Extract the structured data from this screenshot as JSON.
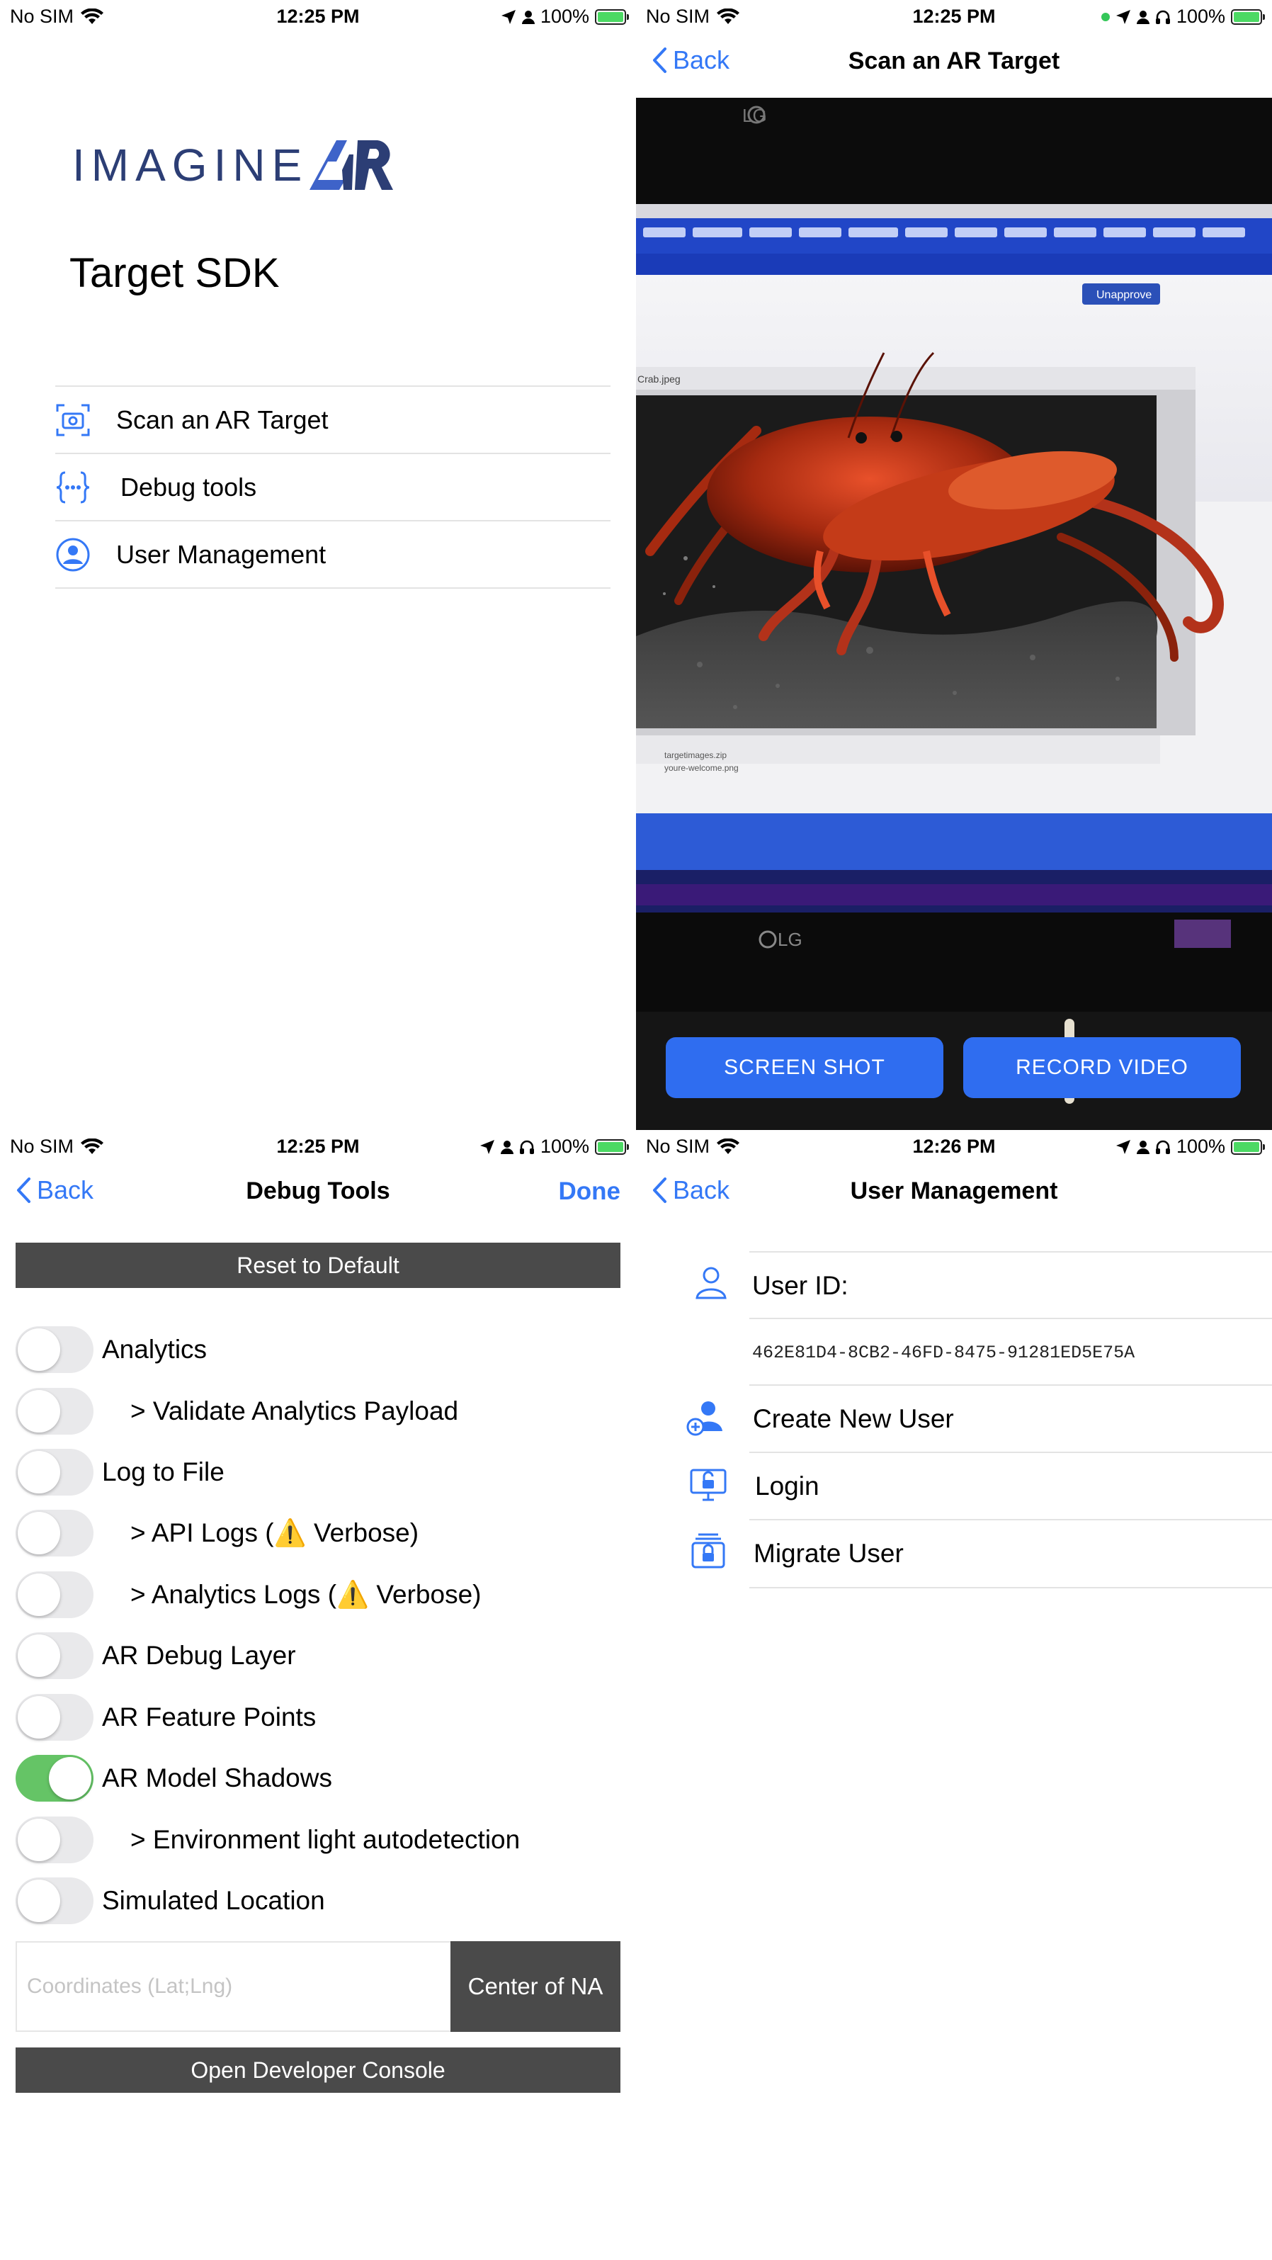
{
  "pane1": {
    "status": {
      "carrier": "No SIM",
      "time": "12:25 PM",
      "battery": "100%"
    },
    "logo": {
      "text": "IMAGINE",
      "mark": "AR"
    },
    "title": "Target SDK",
    "menu": [
      {
        "label": "Scan an AR Target",
        "icon": "camera-scan-icon"
      },
      {
        "label": "Debug tools",
        "icon": "curly-braces-icon"
      },
      {
        "label": "User Management",
        "icon": "person-circle-icon"
      }
    ]
  },
  "pane2": {
    "status": {
      "carrier": "No SIM",
      "time": "12:25 PM",
      "battery": "100%"
    },
    "nav": {
      "back": "Back",
      "title": "Scan an AR Target"
    },
    "camera_overlay": {
      "tv_brand_top": "LG",
      "tv_brand_bottom": "LG",
      "unapprove": "Unapprove",
      "file1": "targetimages.zip",
      "file2": "youre-welcome.png",
      "filename": "Crab.jpeg"
    },
    "buttons": {
      "screenshot": "SCREEN SHOT",
      "record": "RECORD VIDEO"
    }
  },
  "pane3": {
    "status": {
      "carrier": "No SIM",
      "time": "12:25 PM",
      "battery": "100%"
    },
    "nav": {
      "back": "Back",
      "title": "Debug Tools",
      "done": "Done"
    },
    "reset_label": "Reset to Default",
    "toggles": [
      {
        "label": "Analytics",
        "on": false,
        "indent": false
      },
      {
        "label": "> Validate Analytics Payload",
        "on": false,
        "indent": true
      },
      {
        "label": "Log to File",
        "on": false,
        "indent": false
      },
      {
        "label_pre": "> API Logs (",
        "label_post": " Verbose)",
        "warning": "⚠️",
        "on": false,
        "indent": true
      },
      {
        "label_pre": "> Analytics Logs (",
        "label_post": " Verbose)",
        "warning": "⚠️",
        "on": false,
        "indent": true
      },
      {
        "label": "AR Debug Layer",
        "on": false,
        "indent": false
      },
      {
        "label": "AR Feature Points",
        "on": false,
        "indent": false
      },
      {
        "label": "AR Model Shadows",
        "on": true,
        "indent": false
      },
      {
        "label": "> Environment light autodetection",
        "on": false,
        "indent": true
      },
      {
        "label": "Simulated Location",
        "on": false,
        "indent": false
      }
    ],
    "coordinates_placeholder": "Coordinates (Lat;Lng)",
    "center_button": "Center of NA",
    "console_label": "Open Developer Console",
    "switch_on_color": "#65c466"
  },
  "pane4": {
    "status": {
      "carrier": "No SIM",
      "time": "12:26 PM",
      "battery": "100%"
    },
    "nav": {
      "back": "Back",
      "title": "User Management"
    },
    "user_id_label": "User ID:",
    "user_id_value": "462E81D4-8CB2-46FD-8475-91281ED5E75A",
    "actions": [
      {
        "label": "Create New User",
        "icon": "person-add-icon"
      },
      {
        "label": "Login",
        "icon": "login-screen-icon"
      },
      {
        "label": "Migrate User",
        "icon": "migrate-lock-icon"
      }
    ]
  },
  "colors": {
    "accent": "#3478f6",
    "button_blue": "#2f6df0",
    "dark_bar": "#4a4a4a",
    "logo": "#2c3e75"
  }
}
